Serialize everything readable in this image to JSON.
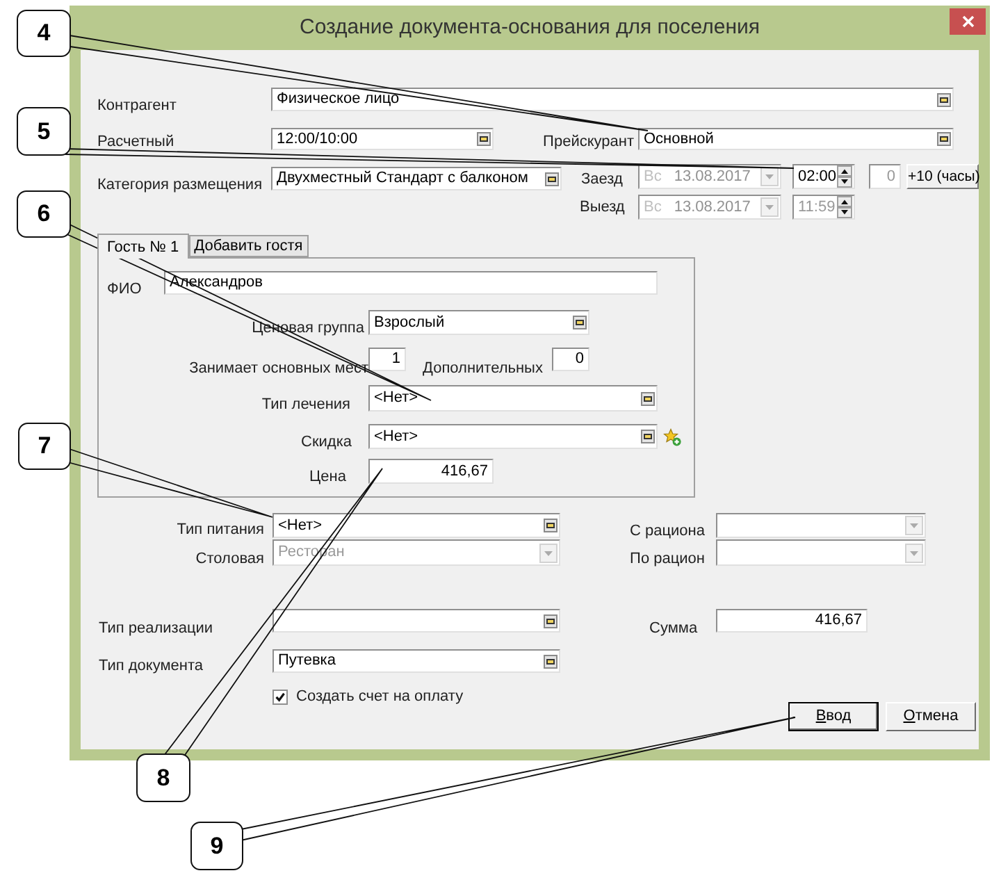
{
  "window": {
    "title": "Создание документа-основания для поселения"
  },
  "header": {
    "counterparty": {
      "label": "Контрагент",
      "value": "Физическое лицо"
    },
    "settlement_hour": {
      "label": "Расчетный",
      "value": "12:00/10:00"
    },
    "price_list": {
      "label": "Прейскурант",
      "value": "Основной"
    },
    "room_category": {
      "label": "Категория размещения",
      "value": "Двухместный Стандарт с балконом"
    },
    "arrival": {
      "label": "Заезд",
      "weekday": "Вс",
      "date": "13.08.2017",
      "date_disabled": true,
      "time": "02:00",
      "time_disabled": false
    },
    "departure": {
      "label": "Выезд",
      "weekday": "Вс",
      "date": "13.08.2017",
      "date_disabled": true,
      "time": "11:59",
      "time_disabled": true
    },
    "time_shift": {
      "value": "0",
      "disabled": true
    },
    "timezone_button": "+10 (часы)"
  },
  "guest_tabs": [
    {
      "label": "Гость № 1",
      "selected": true
    },
    {
      "label": "Добавить гостя",
      "selected": false
    }
  ],
  "guest": {
    "full_name": {
      "label": "ФИО",
      "value": "Александров"
    },
    "price_group": {
      "label": "Ценовая группа",
      "value": "Взрослый"
    },
    "main_places": {
      "label": "Занимает основных мест",
      "value": "1"
    },
    "extra_places": {
      "label": "Дополнительных",
      "value": "0"
    },
    "treatment_type": {
      "label": "Тип лечения",
      "value": "<Нет>"
    },
    "discount": {
      "label": "Скидка",
      "value": "<Нет>"
    },
    "price": {
      "label": "Цена",
      "value": "416,67"
    }
  },
  "meals": {
    "meal_type": {
      "label": "Тип питания",
      "value": "<Нет>"
    },
    "dining_room": {
      "label": "Столовая",
      "value": "Ресторан",
      "disabled": true
    },
    "ration_from": {
      "label": "С рациона",
      "disabled": true
    },
    "ration_to": {
      "label": "По рацион",
      "disabled": true
    }
  },
  "sale_type": {
    "label": "Тип реализации"
  },
  "total": {
    "label": "Сумма",
    "value": "416,67"
  },
  "document_type": {
    "label": "Тип документа",
    "value": "Путевка"
  },
  "create_invoice": {
    "label": "Создать счет на оплату",
    "checked": true
  },
  "buttons": [
    {
      "label": "Ввод",
      "default": true
    },
    {
      "label": "Отмена",
      "default": false
    }
  ],
  "callouts": [
    {
      "number": "4"
    },
    {
      "number": "5"
    },
    {
      "number": "6"
    },
    {
      "number": "7"
    },
    {
      "number": "8"
    },
    {
      "number": "9"
    }
  ]
}
